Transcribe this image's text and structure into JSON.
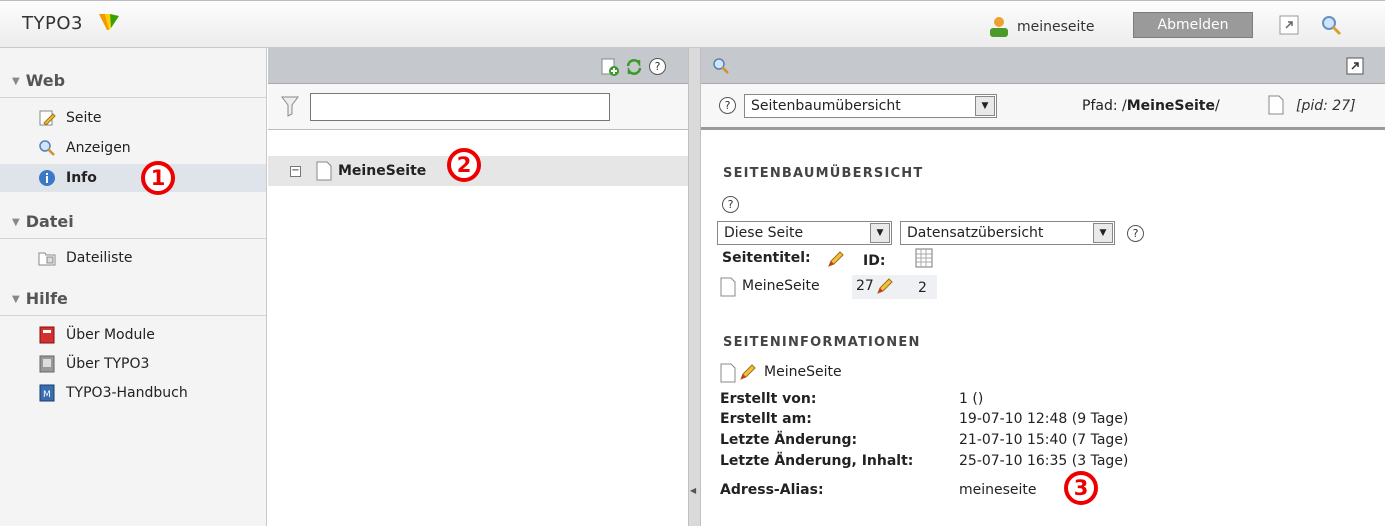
{
  "topbar": {
    "logo_text": "TYPO3",
    "username": "meineseite",
    "logout_label": "Abmelden"
  },
  "sidebar": {
    "sections": [
      {
        "title": "Web",
        "items": [
          {
            "label": "Seite",
            "icon": "page-edit-icon"
          },
          {
            "label": "Anzeigen",
            "icon": "magnifier-icon"
          },
          {
            "label": "Info",
            "icon": "info-icon",
            "active": true
          }
        ]
      },
      {
        "title": "Datei",
        "items": [
          {
            "label": "Dateiliste",
            "icon": "file-list-icon"
          }
        ]
      },
      {
        "title": "Hilfe",
        "items": [
          {
            "label": "Über Module",
            "icon": "book-red-icon"
          },
          {
            "label": "Über TYPO3",
            "icon": "about-icon"
          },
          {
            "label": "TYPO3-Handbuch",
            "icon": "manual-icon"
          }
        ]
      }
    ]
  },
  "tree": {
    "filter_value": "",
    "root_label": "MeineSeite"
  },
  "docheader": {
    "function_select": "Seitenbaumübersicht",
    "path_label": "Pfad: /",
    "path_page": "MeineSeite",
    "path_sep": "/",
    "pid": "[pid: 27]"
  },
  "overview": {
    "heading": "SEITENBAUMÜBERSICHT",
    "depth_select": "Diese Seite",
    "type_select": "Datensatzübersicht",
    "col_title": "Seitentitel:",
    "col_id": "ID:",
    "row_title": "MeineSeite",
    "row_id": "27",
    "row_count": "2"
  },
  "info": {
    "heading": "SEITENINFORMATIONEN",
    "page_title": "MeineSeite",
    "rows": [
      {
        "label": "Erstellt von:",
        "value": "1 ()"
      },
      {
        "label": "Erstellt am:",
        "value": "19-07-10 12:48 (9 Tage)"
      },
      {
        "label": "Letzte Änderung:",
        "value": "21-07-10 15:40 (7 Tage)"
      },
      {
        "label": "Letzte Änderung, Inhalt:",
        "value": "25-07-10 16:35 (3 Tage)"
      },
      {
        "label": "Adress-Alias:",
        "value": "meineseite"
      }
    ]
  },
  "annotations": {
    "one": "1",
    "two": "2",
    "three": "3"
  },
  "colors": {
    "badge": "#e00000",
    "header_gray": "#c5c8cc",
    "sidebar_bg": "#f4f4f4"
  }
}
